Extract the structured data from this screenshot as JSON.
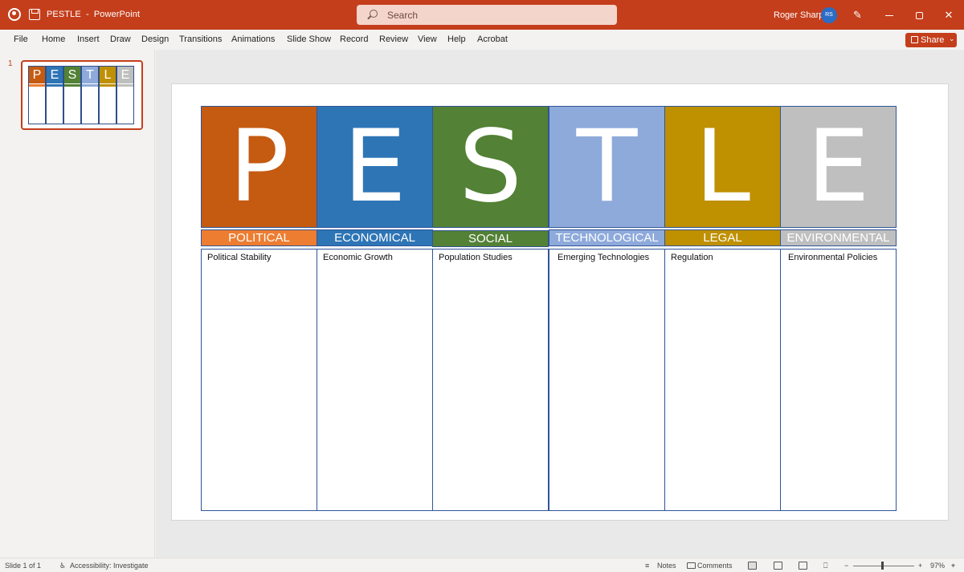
{
  "titlebar": {
    "doc_title": "PESTLE",
    "separator": "-",
    "app_name": "PowerPoint",
    "search_placeholder": "Search",
    "user_name": "Roger Sharp",
    "user_initials": "RS"
  },
  "menu": {
    "items": [
      "File",
      "Home",
      "Insert",
      "Draw",
      "Design",
      "Transitions",
      "Animations",
      "Slide Show",
      "Record",
      "Review",
      "View",
      "Help",
      "Acrobat"
    ],
    "share_label": "Share"
  },
  "thumbnail": {
    "slide_number": "1",
    "letters": [
      "P",
      "E",
      "S",
      "T",
      "L",
      "E"
    ]
  },
  "slide": {
    "columns": [
      {
        "letter": "P",
        "label": "POLITICAL",
        "item": "Political Stability",
        "color": "#c55a11",
        "label_color": "#ed7d31"
      },
      {
        "letter": "E",
        "label": "ECONOMICAL",
        "item": "Economic Growth",
        "color": "#2e75b6",
        "label_color": "#2e75b6"
      },
      {
        "letter": "S",
        "label": "SOCIAL",
        "item": "Population Studies",
        "color": "#538135",
        "label_color": "#538135"
      },
      {
        "letter": "T",
        "label": "TECHNOLOGICAL",
        "item": "Emerging Technologies",
        "color": "#8eaadb",
        "label_color": "#8eaadb"
      },
      {
        "letter": "L",
        "label": "LEGAL",
        "item": "Regulation",
        "color": "#bf9000",
        "label_color": "#bf9000"
      },
      {
        "letter": "E",
        "label": "ENVIRONMENTAL",
        "item": "Environmental Policies",
        "color": "#bfbfbf",
        "label_color": "#bfbfbf"
      }
    ]
  },
  "status": {
    "slide_indicator": "Slide 1 of 1",
    "accessibility": "Accessibility: Investigate",
    "notes_label": "Notes",
    "comments_label": "Comments",
    "zoom_minus": "−",
    "zoom_plus": "+",
    "zoom_level": "97%"
  },
  "colors": {
    "accent": "#c43e1c",
    "border": "#2f5597"
  }
}
